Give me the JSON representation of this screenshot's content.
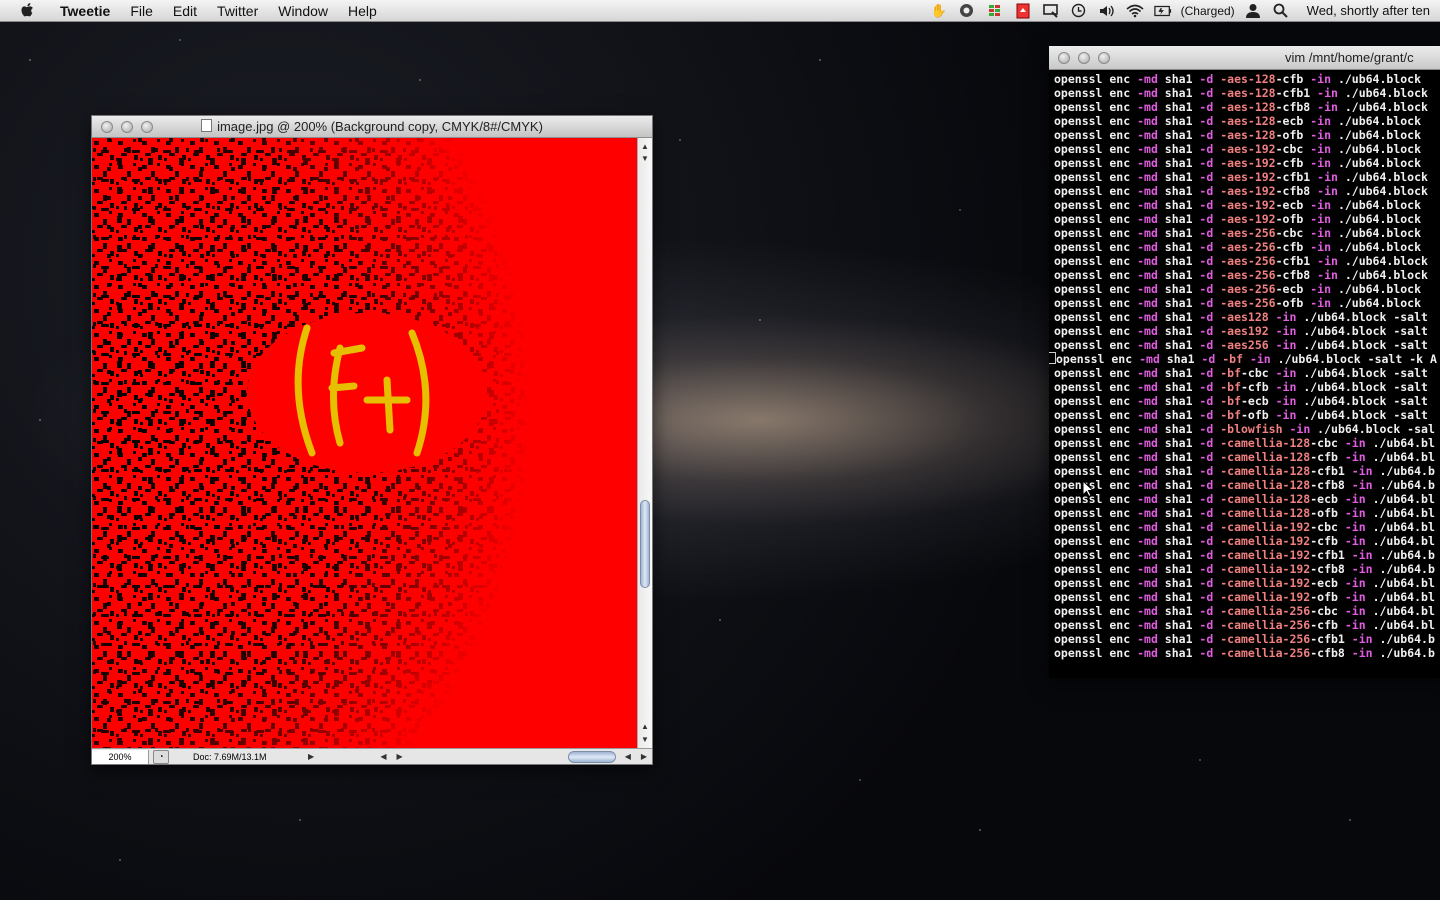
{
  "menubar": {
    "app_name": "Tweetie",
    "items": [
      "File",
      "Edit",
      "Twitter",
      "Window",
      "Help"
    ],
    "battery_status": "(Charged)",
    "clock": "Wed, shortly after ten"
  },
  "photoshop": {
    "title": "image.jpg @ 200% (Background copy, CMYK/8#/CMYK)",
    "zoom": "200%",
    "doc_size": "Doc: 7.69M/13.1M"
  },
  "terminal": {
    "title": "vim  /mnt/home/grant/c",
    "lines": [
      {
        "pre": "openssl enc ",
        "f1": "-md",
        "mid": " sha1 ",
        "f2": "-d",
        "sp": " ",
        "opt": "-aes-128",
        "rest": "-cfb ",
        "f3": "-in",
        "tail": " ./ub64.block"
      },
      {
        "pre": "openssl enc ",
        "f1": "-md",
        "mid": " sha1 ",
        "f2": "-d",
        "sp": " ",
        "opt": "-aes-128",
        "rest": "-cfb1 ",
        "f3": "-in",
        "tail": " ./ub64.block"
      },
      {
        "pre": "openssl enc ",
        "f1": "-md",
        "mid": " sha1 ",
        "f2": "-d",
        "sp": " ",
        "opt": "-aes-128",
        "rest": "-cfb8 ",
        "f3": "-in",
        "tail": " ./ub64.block"
      },
      {
        "pre": "openssl enc ",
        "f1": "-md",
        "mid": " sha1 ",
        "f2": "-d",
        "sp": " ",
        "opt": "-aes-128",
        "rest": "-ecb ",
        "f3": "-in",
        "tail": " ./ub64.block"
      },
      {
        "pre": "openssl enc ",
        "f1": "-md",
        "mid": " sha1 ",
        "f2": "-d",
        "sp": " ",
        "opt": "-aes-128",
        "rest": "-ofb ",
        "f3": "-in",
        "tail": " ./ub64.block"
      },
      {
        "pre": "openssl enc ",
        "f1": "-md",
        "mid": " sha1 ",
        "f2": "-d",
        "sp": " ",
        "opt": "-aes-192",
        "rest": "-cbc ",
        "f3": "-in",
        "tail": " ./ub64.block"
      },
      {
        "pre": "openssl enc ",
        "f1": "-md",
        "mid": " sha1 ",
        "f2": "-d",
        "sp": " ",
        "opt": "-aes-192",
        "rest": "-cfb ",
        "f3": "-in",
        "tail": " ./ub64.block"
      },
      {
        "pre": "openssl enc ",
        "f1": "-md",
        "mid": " sha1 ",
        "f2": "-d",
        "sp": " ",
        "opt": "-aes-192",
        "rest": "-cfb1 ",
        "f3": "-in",
        "tail": " ./ub64.block"
      },
      {
        "pre": "openssl enc ",
        "f1": "-md",
        "mid": " sha1 ",
        "f2": "-d",
        "sp": " ",
        "opt": "-aes-192",
        "rest": "-cfb8 ",
        "f3": "-in",
        "tail": " ./ub64.block"
      },
      {
        "pre": "openssl enc ",
        "f1": "-md",
        "mid": " sha1 ",
        "f2": "-d",
        "sp": " ",
        "opt": "-aes-192",
        "rest": "-ecb ",
        "f3": "-in",
        "tail": " ./ub64.block"
      },
      {
        "pre": "openssl enc ",
        "f1": "-md",
        "mid": " sha1 ",
        "f2": "-d",
        "sp": " ",
        "opt": "-aes-192",
        "rest": "-ofb ",
        "f3": "-in",
        "tail": " ./ub64.block"
      },
      {
        "pre": "openssl enc ",
        "f1": "-md",
        "mid": " sha1 ",
        "f2": "-d",
        "sp": " ",
        "opt": "-aes-256",
        "rest": "-cbc ",
        "f3": "-in",
        "tail": " ./ub64.block"
      },
      {
        "pre": "openssl enc ",
        "f1": "-md",
        "mid": " sha1 ",
        "f2": "-d",
        "sp": " ",
        "opt": "-aes-256",
        "rest": "-cfb ",
        "f3": "-in",
        "tail": " ./ub64.block"
      },
      {
        "pre": "openssl enc ",
        "f1": "-md",
        "mid": " sha1 ",
        "f2": "-d",
        "sp": " ",
        "opt": "-aes-256",
        "rest": "-cfb1 ",
        "f3": "-in",
        "tail": " ./ub64.block"
      },
      {
        "pre": "openssl enc ",
        "f1": "-md",
        "mid": " sha1 ",
        "f2": "-d",
        "sp": " ",
        "opt": "-aes-256",
        "rest": "-cfb8 ",
        "f3": "-in",
        "tail": " ./ub64.block"
      },
      {
        "pre": "openssl enc ",
        "f1": "-md",
        "mid": " sha1 ",
        "f2": "-d",
        "sp": " ",
        "opt": "-aes-256",
        "rest": "-ecb ",
        "f3": "-in",
        "tail": " ./ub64.block"
      },
      {
        "pre": "openssl enc ",
        "f1": "-md",
        "mid": " sha1 ",
        "f2": "-d",
        "sp": " ",
        "opt": "-aes-256",
        "rest": "-ofb ",
        "f3": "-in",
        "tail": " ./ub64.block"
      },
      {
        "pre": "openssl enc ",
        "f1": "-md",
        "mid": " sha1 ",
        "f2": "-d",
        "sp": " ",
        "opt": "-aes128",
        "rest": " ",
        "f3": "-in",
        "tail": " ./ub64.block -salt"
      },
      {
        "pre": "openssl enc ",
        "f1": "-md",
        "mid": " sha1 ",
        "f2": "-d",
        "sp": " ",
        "opt": "-aes192",
        "rest": " ",
        "f3": "-in",
        "tail": " ./ub64.block -salt"
      },
      {
        "pre": "openssl enc ",
        "f1": "-md",
        "mid": " sha1 ",
        "f2": "-d",
        "sp": " ",
        "opt": "-aes256",
        "rest": " ",
        "f3": "-in",
        "tail": " ./ub64.block -salt"
      },
      {
        "pre": "openssl enc ",
        "f1": "-md",
        "mid": " sha1 ",
        "f2": "-d",
        "sp": " ",
        "opt": "-bf",
        "rest": " ",
        "f3": "-in",
        "tail": " ./ub64.block -salt -k A"
      },
      {
        "pre": "openssl enc ",
        "f1": "-md",
        "mid": " sha1 ",
        "f2": "-d",
        "sp": " ",
        "opt": "-bf",
        "rest": "-cbc ",
        "f3": "-in",
        "tail": " ./ub64.block -salt"
      },
      {
        "pre": "openssl enc ",
        "f1": "-md",
        "mid": " sha1 ",
        "f2": "-d",
        "sp": " ",
        "opt": "-bf",
        "rest": "-cfb ",
        "f3": "-in",
        "tail": " ./ub64.block -salt"
      },
      {
        "pre": "openssl enc ",
        "f1": "-md",
        "mid": " sha1 ",
        "f2": "-d",
        "sp": " ",
        "opt": "-bf",
        "rest": "-ecb ",
        "f3": "-in",
        "tail": " ./ub64.block -salt"
      },
      {
        "pre": "openssl enc ",
        "f1": "-md",
        "mid": " sha1 ",
        "f2": "-d",
        "sp": " ",
        "opt": "-bf",
        "rest": "-ofb ",
        "f3": "-in",
        "tail": " ./ub64.block -salt"
      },
      {
        "pre": "openssl enc ",
        "f1": "-md",
        "mid": " sha1 ",
        "f2": "-d",
        "sp": " ",
        "opt": "-blowfish",
        "rest": " ",
        "f3": "-in",
        "tail": " ./ub64.block -sal"
      },
      {
        "pre": "openssl enc ",
        "f1": "-md",
        "mid": " sha1 ",
        "f2": "-d",
        "sp": " ",
        "opt": "-camellia-128",
        "rest": "-cbc ",
        "f3": "-in",
        "tail": " ./ub64.bl"
      },
      {
        "pre": "openssl enc ",
        "f1": "-md",
        "mid": " sha1 ",
        "f2": "-d",
        "sp": " ",
        "opt": "-camellia-128",
        "rest": "-cfb ",
        "f3": "-in",
        "tail": " ./ub64.bl"
      },
      {
        "pre": "openssl enc ",
        "f1": "-md",
        "mid": " sha1 ",
        "f2": "-d",
        "sp": " ",
        "opt": "-camellia-128",
        "rest": "-cfb1 ",
        "f3": "-in",
        "tail": " ./ub64.b"
      },
      {
        "pre": "openssl enc ",
        "f1": "-md",
        "mid": " sha1 ",
        "f2": "-d",
        "sp": " ",
        "opt": "-camellia-128",
        "rest": "-cfb8 ",
        "f3": "-in",
        "tail": " ./ub64.b"
      },
      {
        "pre": "openssl enc ",
        "f1": "-md",
        "mid": " sha1 ",
        "f2": "-d",
        "sp": " ",
        "opt": "-camellia-128",
        "rest": "-ecb ",
        "f3": "-in",
        "tail": " ./ub64.bl"
      },
      {
        "pre": "openssl enc ",
        "f1": "-md",
        "mid": " sha1 ",
        "f2": "-d",
        "sp": " ",
        "opt": "-camellia-128",
        "rest": "-ofb ",
        "f3": "-in",
        "tail": " ./ub64.bl"
      },
      {
        "pre": "openssl enc ",
        "f1": "-md",
        "mid": " sha1 ",
        "f2": "-d",
        "sp": " ",
        "opt": "-camellia-192",
        "rest": "-cbc ",
        "f3": "-in",
        "tail": " ./ub64.bl"
      },
      {
        "pre": "openssl enc ",
        "f1": "-md",
        "mid": " sha1 ",
        "f2": "-d",
        "sp": " ",
        "opt": "-camellia-192",
        "rest": "-cfb ",
        "f3": "-in",
        "tail": " ./ub64.bl"
      },
      {
        "pre": "openssl enc ",
        "f1": "-md",
        "mid": " sha1 ",
        "f2": "-d",
        "sp": " ",
        "opt": "-camellia-192",
        "rest": "-cfb1 ",
        "f3": "-in",
        "tail": " ./ub64.b"
      },
      {
        "pre": "openssl enc ",
        "f1": "-md",
        "mid": " sha1 ",
        "f2": "-d",
        "sp": " ",
        "opt": "-camellia-192",
        "rest": "-cfb8 ",
        "f3": "-in",
        "tail": " ./ub64.b"
      },
      {
        "pre": "openssl enc ",
        "f1": "-md",
        "mid": " sha1 ",
        "f2": "-d",
        "sp": " ",
        "opt": "-camellia-192",
        "rest": "-ecb ",
        "f3": "-in",
        "tail": " ./ub64.bl"
      },
      {
        "pre": "openssl enc ",
        "f1": "-md",
        "mid": " sha1 ",
        "f2": "-d",
        "sp": " ",
        "opt": "-camellia-192",
        "rest": "-ofb ",
        "f3": "-in",
        "tail": " ./ub64.bl"
      },
      {
        "pre": "openssl enc ",
        "f1": "-md",
        "mid": " sha1 ",
        "f2": "-d",
        "sp": " ",
        "opt": "-camellia-256",
        "rest": "-cbc ",
        "f3": "-in",
        "tail": " ./ub64.bl"
      },
      {
        "pre": "openssl enc ",
        "f1": "-md",
        "mid": " sha1 ",
        "f2": "-d",
        "sp": " ",
        "opt": "-camellia-256",
        "rest": "-cfb ",
        "f3": "-in",
        "tail": " ./ub64.bl"
      },
      {
        "pre": "openssl enc ",
        "f1": "-md",
        "mid": " sha1 ",
        "f2": "-d",
        "sp": " ",
        "opt": "-camellia-256",
        "rest": "-cfb1 ",
        "f3": "-in",
        "tail": " ./ub64.b"
      },
      {
        "pre": "openssl enc ",
        "f1": "-md",
        "mid": " sha1 ",
        "f2": "-d",
        "sp": " ",
        "opt": "-camellia-256",
        "rest": "-cfb8 ",
        "f3": "-in",
        "tail": " ./ub64.b"
      }
    ]
  },
  "colors": {
    "canvas_red": "#ff0000",
    "flag_magenta": "#e05de0",
    "cipher_salmon": "#f08080"
  },
  "icons": [
    "apple-icon",
    "hand-icon",
    "quicksilver-icon",
    "bars-icon",
    "backup-icon",
    "screen-icon",
    "time-machine-icon",
    "volume-icon",
    "wifi-icon",
    "battery-icon",
    "user-icon",
    "spotlight-icon"
  ]
}
